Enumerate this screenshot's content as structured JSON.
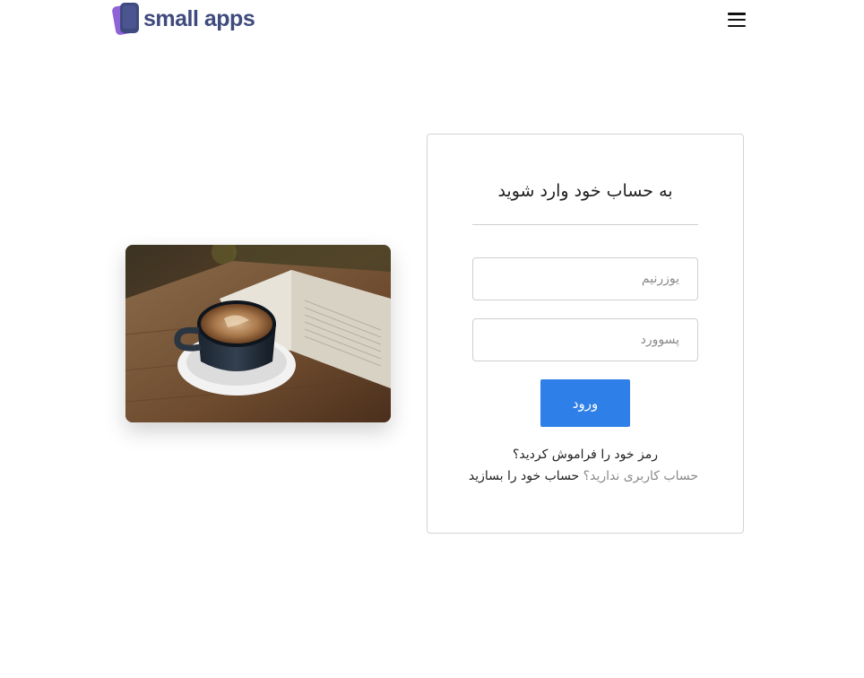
{
  "header": {
    "brand": "small apps",
    "brand_colors": {
      "primary": "#3f4a7e",
      "secondary": "#8e63d8"
    },
    "menu_icon": "hamburger-menu-icon"
  },
  "hero_image": {
    "alt": "فنجان قهوه و کتاب باز روی میز چوبی"
  },
  "login": {
    "title": "به حساب خود وارد شوید",
    "username_placeholder": "یوزرنیم",
    "password_placeholder": "پسوورد",
    "submit_label": "ورود",
    "forgot_password": "رمز خود را فراموش کردید؟",
    "no_account_text": "حساب کاربری ندارید؟",
    "signup_link": "حساب خود را بسازید",
    "accent_color": "#2f7fe8"
  }
}
